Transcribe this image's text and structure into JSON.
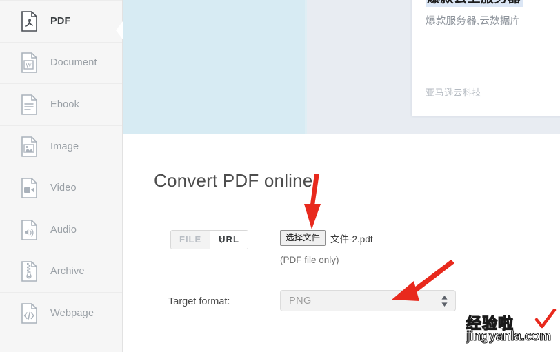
{
  "sidebar": {
    "items": [
      {
        "label": "PDF",
        "icon": "pdf-file-icon",
        "active": true
      },
      {
        "label": "Document",
        "icon": "word-file-icon",
        "active": false
      },
      {
        "label": "Ebook",
        "icon": "ebook-file-icon",
        "active": false
      },
      {
        "label": "Image",
        "icon": "image-file-icon",
        "active": false
      },
      {
        "label": "Video",
        "icon": "video-file-icon",
        "active": false
      },
      {
        "label": "Audio",
        "icon": "audio-file-icon",
        "active": false
      },
      {
        "label": "Archive",
        "icon": "archive-file-icon",
        "active": false
      },
      {
        "label": "Webpage",
        "icon": "webpage-file-icon",
        "active": false
      }
    ],
    "collapse_icon": "chevron-left-icon"
  },
  "banner": {
    "ad": {
      "title": "爆款云上服务器",
      "subtitle": "爆款服务器,云数据库",
      "brand": "亚马逊云科技"
    }
  },
  "main": {
    "title": "Convert PDF online",
    "source": {
      "file_tab": "FILE",
      "url_tab": "URL",
      "colon": ":",
      "choose_button": "选择文件",
      "file_name": "文件-2.pdf",
      "note": "(PDF file only)"
    },
    "format": {
      "label": "Target format:",
      "value": "PNG",
      "stepper_icon": "stepper-updown-icon"
    }
  },
  "watermark": {
    "cn": "经验啦",
    "check_icon": "red-check-icon",
    "url": "jingyanla.com"
  },
  "colors": {
    "accent_red": "#e8291d",
    "cyan_panel": "#d7ebf3",
    "bluegray_panel": "#e8ecf2",
    "sidebar_bg": "#f6f6f6",
    "active_text": "#3c4043",
    "muted_text": "#9aa0a6"
  }
}
